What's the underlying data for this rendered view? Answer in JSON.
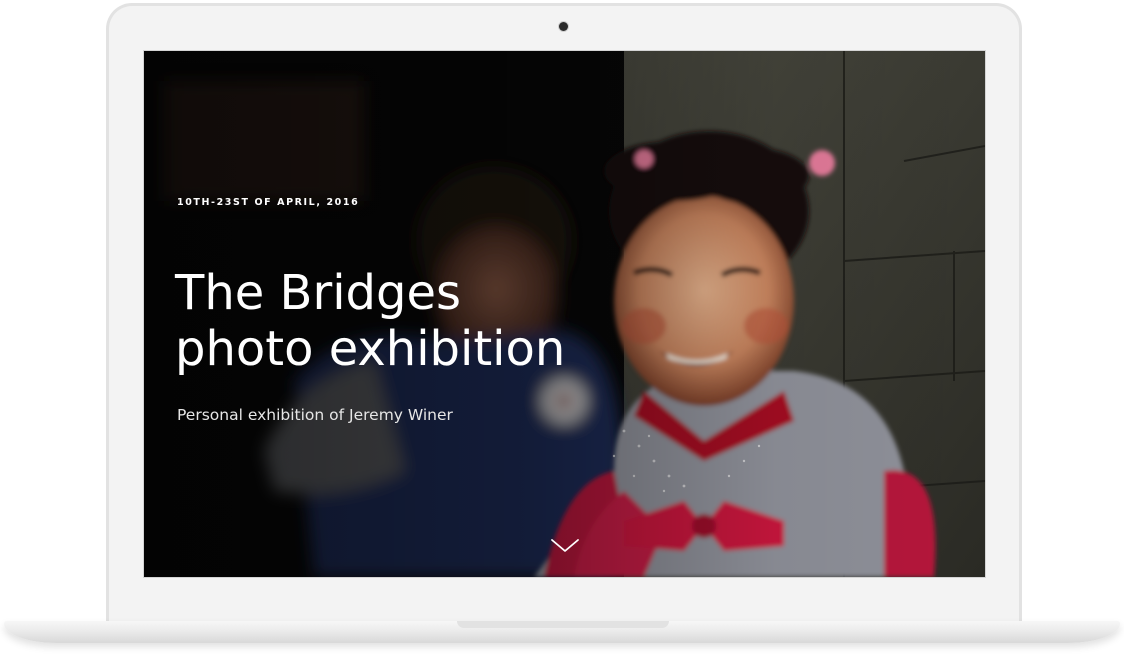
{
  "hero": {
    "date": "10TH-23ST OF APRIL, 2016",
    "title_line1": "The Bridges",
    "title_line2": "photo exhibition",
    "subtitle": "Personal exhibition of Jeremy Winer"
  },
  "icons": {
    "scroll_down": "chevron-down-icon",
    "camera": "camera-dot-icon"
  },
  "colors": {
    "bezel": "#f3f3f3",
    "text": "#ffffff",
    "subtitle": "#e6e6e6"
  }
}
